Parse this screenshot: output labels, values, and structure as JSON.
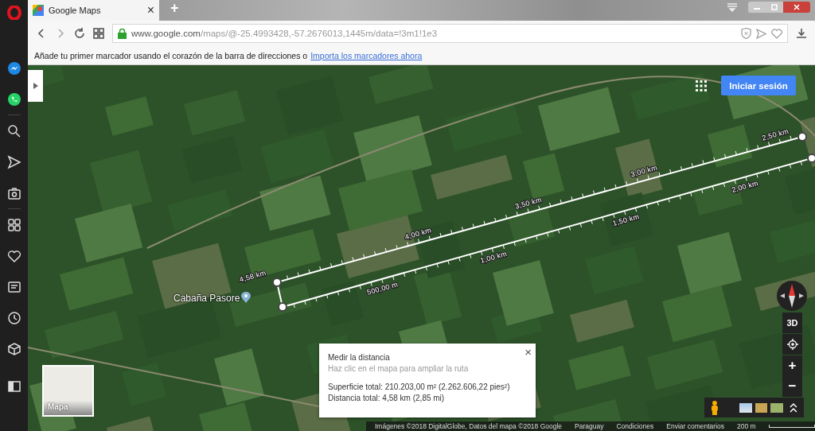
{
  "browser": {
    "tab": {
      "title": "Google Maps",
      "close": "×"
    },
    "new_tab": "+",
    "url": {
      "host": "www.google.com",
      "path": "/maps/@-25.4993428,-57.2676013,1445m/data=!3m1!1e3"
    },
    "bookmark_hint": {
      "text": "Añade tu primer marcador usando el corazón de la barra de direcciones o",
      "link": "Importa los marcadores ahora"
    }
  },
  "map": {
    "sign_in": "Iniciar sesión",
    "place_label": "Cabaña Pasore",
    "route_top_labels": [
      "4,58 km",
      "4,00 km",
      "3,50 km",
      "3,00 km",
      "2,50 km"
    ],
    "route_bottom_labels": [
      "500,00 m",
      "1,00 km",
      "1,50 km",
      "2,00 km"
    ],
    "view_3d": "3D",
    "zoom_in": "+",
    "zoom_out": "−",
    "layer_thumb": "Mapa"
  },
  "measure_card": {
    "title": "Medir la distancia",
    "hint": "Haz clic en el mapa para ampliar la ruta",
    "area": "Superficie total: 210.203,00 m² (2.262.606,22 pies²)",
    "distance": "Distancia total: 4,58 km (2,85 mi)",
    "close": "×"
  },
  "footer": {
    "imagery": "Imágenes ©2018 DigitalGlobe, Datos del mapa ©2018 Google",
    "country": "Paraguay",
    "terms": "Condiciones",
    "feedback": "Enviar comentarios",
    "scale": "200 m"
  }
}
